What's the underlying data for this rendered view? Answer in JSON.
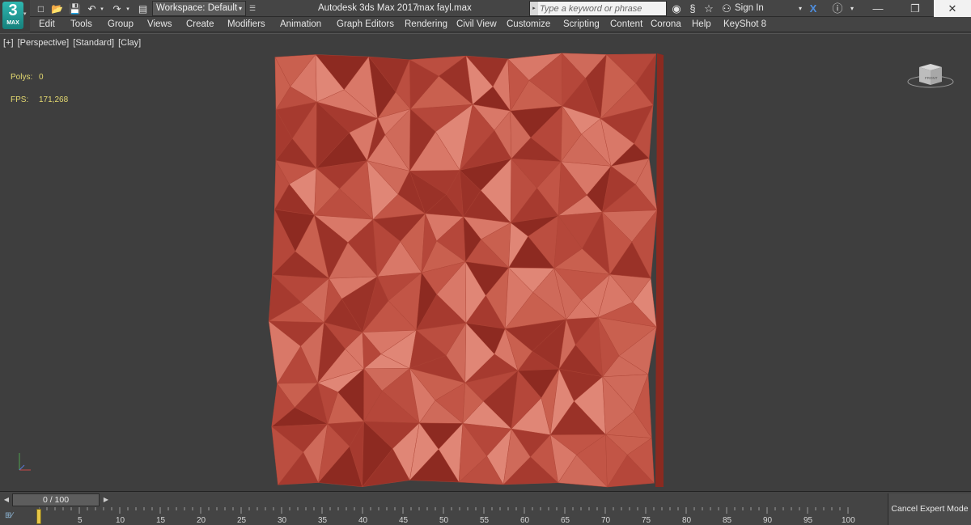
{
  "app": {
    "logo_number": "3",
    "logo_text": "MAX",
    "title": "Autodesk 3ds Max 2017",
    "file": "max fayl.max"
  },
  "quick_access": {
    "workspace_value": "Workspace: Default"
  },
  "search": {
    "placeholder": "Type a keyword or phrase"
  },
  "account": {
    "sign_in": "Sign In"
  },
  "menu": [
    "Edit",
    "Tools",
    "Group",
    "Views",
    "Create",
    "Modifiers",
    "Animation",
    "Graph Editors",
    "Rendering",
    "Civil View",
    "Customize",
    "Scripting",
    "Content",
    "Corona",
    "Help",
    "KeyShot 8"
  ],
  "viewport": {
    "labels": [
      "[+]",
      "[Perspective]",
      "[Standard]",
      "[Clay]"
    ],
    "stats": {
      "polys_label": "Polys:",
      "polys_value": "0",
      "fps_label": "FPS:",
      "fps_value": "171,268"
    },
    "viewcube_label": "FRONT",
    "model_colors": [
      "#b5473a",
      "#c25546",
      "#cf6a5a",
      "#a63a2f",
      "#d97868",
      "#9a3228",
      "#c9604f",
      "#e08676",
      "#8d2a21",
      "#bb4e40"
    ]
  },
  "timeline": {
    "frame_display": "0 / 100",
    "ticks": [
      "5",
      "10",
      "15",
      "20",
      "25",
      "30",
      "35",
      "40",
      "45",
      "50",
      "55",
      "60",
      "65",
      "70",
      "75",
      "80",
      "85",
      "90",
      "95",
      "100"
    ],
    "expert_button": "Cancel Expert Mode"
  }
}
